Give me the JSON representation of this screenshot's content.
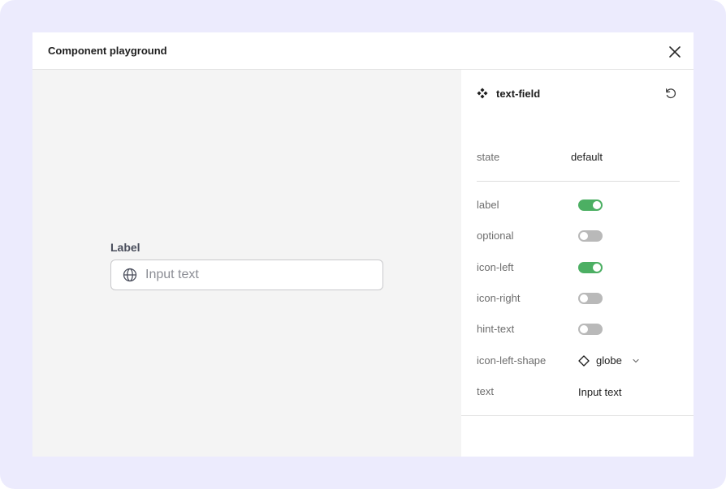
{
  "modal": {
    "title": "Component playground"
  },
  "preview": {
    "field_label": "Label",
    "input_text": "Input text",
    "input_icon": "globe-icon"
  },
  "panel": {
    "component_name": "text-field",
    "component_icon": "component-icon",
    "reset_icon": "reset-icon",
    "state": {
      "label": "state",
      "value": "default"
    },
    "props": {
      "label": {
        "label": "label",
        "on": true
      },
      "optional": {
        "label": "optional",
        "on": false
      },
      "icon_left": {
        "label": "icon-left",
        "on": true
      },
      "icon_right": {
        "label": "icon-right",
        "on": false
      },
      "hint_text": {
        "label": "hint-text",
        "on": false
      }
    },
    "icon_left_shape": {
      "label": "icon-left-shape",
      "value": "globe"
    },
    "text": {
      "label": "text",
      "value": "Input text"
    }
  },
  "colors": {
    "background": "#ecebfd",
    "toggle_on": "#4caf63",
    "toggle_off": "#b9b9b9"
  }
}
